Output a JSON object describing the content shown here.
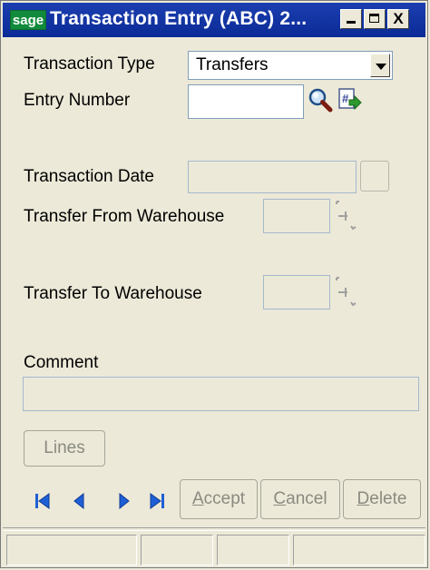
{
  "window": {
    "logo_text": "sage",
    "title": "Transaction Entry (ABC) 2...",
    "close_glyph": "X"
  },
  "form": {
    "transaction_type_label": "Transaction Type",
    "transaction_type_value": "Transfers",
    "entry_number_label": "Entry Number",
    "entry_number_value": "",
    "transaction_date_label": "Transaction Date",
    "transaction_date_value": "",
    "from_warehouse_label": "Transfer From Warehouse",
    "from_warehouse_value": "",
    "to_warehouse_label": "Transfer To Warehouse",
    "to_warehouse_value": "",
    "comment_label": "Comment",
    "comment_value": ""
  },
  "buttons": {
    "lines": "Lines",
    "accept_prefix": "",
    "accept_hotkey": "A",
    "accept_rest": "ccept",
    "cancel_hotkey": "C",
    "cancel_rest": "ancel",
    "delete_hotkey": "D",
    "delete_rest": "elete"
  },
  "icons": {
    "search": "magnifier-icon",
    "next_number": "next-number-icon",
    "calendar": "calendar-button-icon",
    "lookup": "lookup-icon",
    "nav": [
      "first-record-icon",
      "previous-record-icon",
      "next-record-icon",
      "last-record-icon"
    ]
  },
  "colors": {
    "title_bar": "#0a2a96",
    "sage_green": "#118a3c",
    "nav_blue": "#1f5fd6"
  }
}
